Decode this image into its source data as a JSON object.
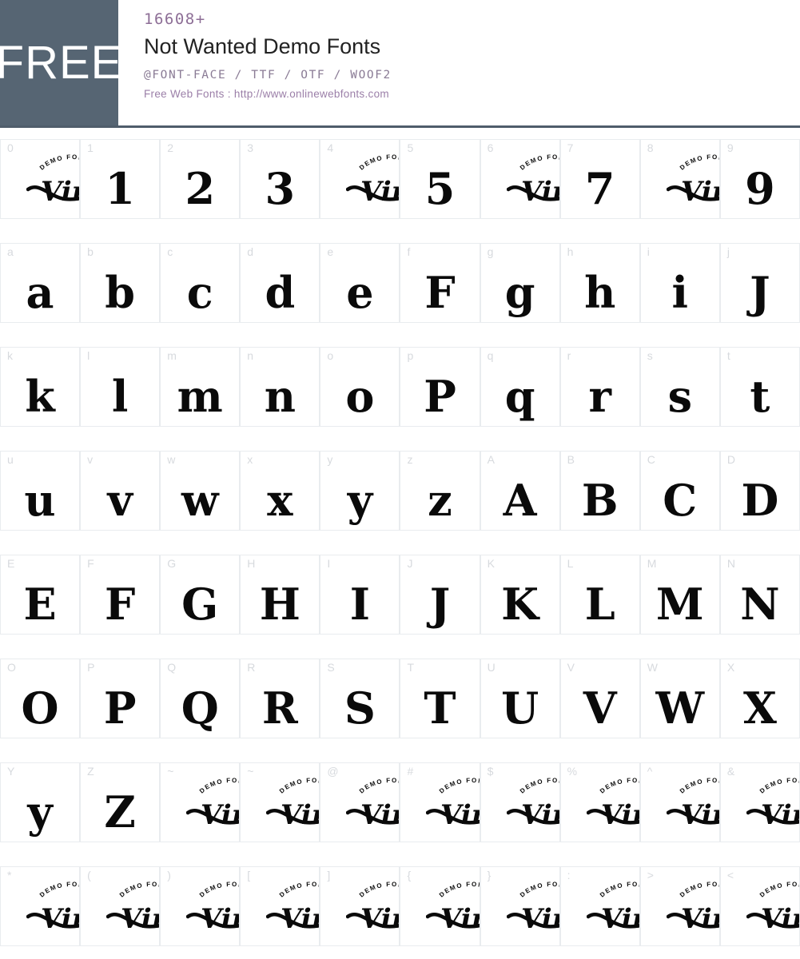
{
  "header": {
    "badge_label": "FREE",
    "counter": "16608+",
    "title": "Not Wanted Demo Fonts",
    "formats": "@FONT-FACE / TTF / OTF / WOOF2",
    "webfonts": "Free Web Fonts : http://www.onlinewebfonts.com",
    "badge_color": "#566573",
    "counter_color": "#8d6e96",
    "accent_color": "#9b7fa8",
    "rule_color": "#4f5d6b"
  },
  "logo": {
    "script_text": "Vinty",
    "arc_text": "DEMO FONT"
  },
  "rows": [
    {
      "cells": [
        {
          "label": "0",
          "glyph": "",
          "is_logo": true
        },
        {
          "label": "1",
          "glyph": "1",
          "is_logo": false
        },
        {
          "label": "2",
          "glyph": "2",
          "is_logo": false
        },
        {
          "label": "3",
          "glyph": "3",
          "is_logo": false
        },
        {
          "label": "4",
          "glyph": "",
          "is_logo": true
        },
        {
          "label": "5",
          "glyph": "5",
          "is_logo": false
        },
        {
          "label": "6",
          "glyph": "",
          "is_logo": true
        },
        {
          "label": "7",
          "glyph": "7",
          "is_logo": false
        },
        {
          "label": "8",
          "glyph": "",
          "is_logo": true
        },
        {
          "label": "9",
          "glyph": "9",
          "is_logo": false
        }
      ]
    },
    {
      "cells": [
        {
          "label": "a",
          "glyph": "a",
          "is_logo": false
        },
        {
          "label": "b",
          "glyph": "b",
          "is_logo": false
        },
        {
          "label": "c",
          "glyph": "c",
          "is_logo": false
        },
        {
          "label": "d",
          "glyph": "d",
          "is_logo": false
        },
        {
          "label": "e",
          "glyph": "e",
          "is_logo": false
        },
        {
          "label": "f",
          "glyph": "F",
          "is_logo": false
        },
        {
          "label": "g",
          "glyph": "g",
          "is_logo": false
        },
        {
          "label": "h",
          "glyph": "h",
          "is_logo": false
        },
        {
          "label": "i",
          "glyph": "i",
          "is_logo": false
        },
        {
          "label": "j",
          "glyph": "J",
          "is_logo": false
        }
      ]
    },
    {
      "cells": [
        {
          "label": "k",
          "glyph": "k",
          "is_logo": false
        },
        {
          "label": "l",
          "glyph": "l",
          "is_logo": false
        },
        {
          "label": "m",
          "glyph": "m",
          "is_logo": false
        },
        {
          "label": "n",
          "glyph": "n",
          "is_logo": false
        },
        {
          "label": "o",
          "glyph": "o",
          "is_logo": false
        },
        {
          "label": "p",
          "glyph": "P",
          "is_logo": false
        },
        {
          "label": "q",
          "glyph": "q",
          "is_logo": false
        },
        {
          "label": "r",
          "glyph": "r",
          "is_logo": false
        },
        {
          "label": "s",
          "glyph": "s",
          "is_logo": false
        },
        {
          "label": "t",
          "glyph": "t",
          "is_logo": false
        }
      ]
    },
    {
      "cells": [
        {
          "label": "u",
          "glyph": "u",
          "is_logo": false
        },
        {
          "label": "v",
          "glyph": "v",
          "is_logo": false
        },
        {
          "label": "w",
          "glyph": "w",
          "is_logo": false
        },
        {
          "label": "x",
          "glyph": "x",
          "is_logo": false
        },
        {
          "label": "y",
          "glyph": "y",
          "is_logo": false
        },
        {
          "label": "z",
          "glyph": "z",
          "is_logo": false
        },
        {
          "label": "A",
          "glyph": "A",
          "is_logo": false
        },
        {
          "label": "B",
          "glyph": "B",
          "is_logo": false
        },
        {
          "label": "C",
          "glyph": "C",
          "is_logo": false
        },
        {
          "label": "D",
          "glyph": "D",
          "is_logo": false
        }
      ]
    },
    {
      "cells": [
        {
          "label": "E",
          "glyph": "E",
          "is_logo": false
        },
        {
          "label": "F",
          "glyph": "F",
          "is_logo": false
        },
        {
          "label": "G",
          "glyph": "G",
          "is_logo": false
        },
        {
          "label": "H",
          "glyph": "H",
          "is_logo": false
        },
        {
          "label": "I",
          "glyph": "I",
          "is_logo": false
        },
        {
          "label": "J",
          "glyph": "J",
          "is_logo": false
        },
        {
          "label": "K",
          "glyph": "K",
          "is_logo": false
        },
        {
          "label": "L",
          "glyph": "L",
          "is_logo": false
        },
        {
          "label": "M",
          "glyph": "M",
          "is_logo": false
        },
        {
          "label": "N",
          "glyph": "N",
          "is_logo": false
        }
      ]
    },
    {
      "cells": [
        {
          "label": "O",
          "glyph": "O",
          "is_logo": false
        },
        {
          "label": "P",
          "glyph": "P",
          "is_logo": false
        },
        {
          "label": "Q",
          "glyph": "Q",
          "is_logo": false
        },
        {
          "label": "R",
          "glyph": "R",
          "is_logo": false
        },
        {
          "label": "S",
          "glyph": "S",
          "is_logo": false
        },
        {
          "label": "T",
          "glyph": "T",
          "is_logo": false
        },
        {
          "label": "U",
          "glyph": "U",
          "is_logo": false
        },
        {
          "label": "V",
          "glyph": "V",
          "is_logo": false
        },
        {
          "label": "W",
          "glyph": "W",
          "is_logo": false
        },
        {
          "label": "X",
          "glyph": "X",
          "is_logo": false
        }
      ]
    },
    {
      "cells": [
        {
          "label": "Y",
          "glyph": "y",
          "is_logo": false
        },
        {
          "label": "Z",
          "glyph": "Z",
          "is_logo": false
        },
        {
          "label": "~",
          "glyph": "",
          "is_logo": true
        },
        {
          "label": "~",
          "glyph": "",
          "is_logo": true
        },
        {
          "label": "@",
          "glyph": "",
          "is_logo": true
        },
        {
          "label": "#",
          "glyph": "",
          "is_logo": true
        },
        {
          "label": "$",
          "glyph": "",
          "is_logo": true
        },
        {
          "label": "%",
          "glyph": "",
          "is_logo": true
        },
        {
          "label": "^",
          "glyph": "",
          "is_logo": true
        },
        {
          "label": "&",
          "glyph": "",
          "is_logo": true
        }
      ]
    },
    {
      "cells": [
        {
          "label": "*",
          "glyph": "",
          "is_logo": true
        },
        {
          "label": "(",
          "glyph": "",
          "is_logo": true
        },
        {
          "label": ")",
          "glyph": "",
          "is_logo": true
        },
        {
          "label": "[",
          "glyph": "",
          "is_logo": true
        },
        {
          "label": "]",
          "glyph": "",
          "is_logo": true
        },
        {
          "label": "{",
          "glyph": "",
          "is_logo": true
        },
        {
          "label": "}",
          "glyph": "",
          "is_logo": true
        },
        {
          "label": ":",
          "glyph": "",
          "is_logo": true
        },
        {
          "label": ">",
          "glyph": "",
          "is_logo": true
        },
        {
          "label": "<",
          "glyph": "",
          "is_logo": true
        }
      ]
    }
  ]
}
